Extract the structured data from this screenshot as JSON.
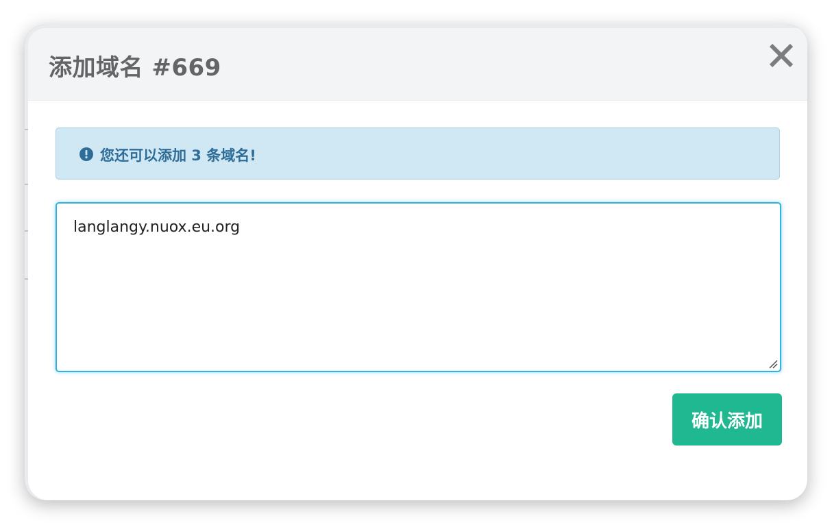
{
  "modal": {
    "title": "添加域名 #669",
    "close_label": "×"
  },
  "alert": {
    "icon": "exclamation-circle-icon",
    "text": "您还可以添加 3 条域名!"
  },
  "domain_input": {
    "value": "langlangy.nuox.eu.org"
  },
  "actions": {
    "confirm_label": "确认添加"
  },
  "colors": {
    "header_bg": "#f3f4f6",
    "alert_bg": "#d0e8f4",
    "alert_text": "#2f6d99",
    "focus_border": "#33b2de",
    "confirm_bg": "#1fb890"
  }
}
